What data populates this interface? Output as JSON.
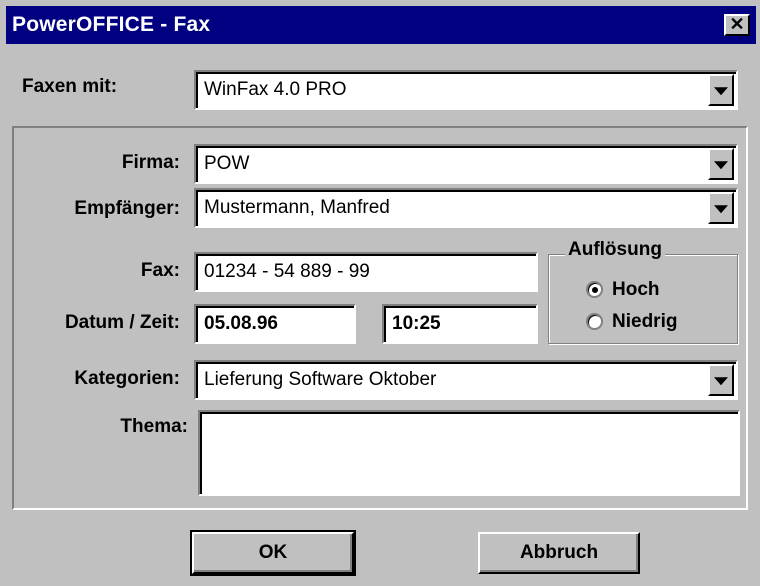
{
  "window": {
    "title": "PowerOFFICE - Fax",
    "close_label": "✕"
  },
  "colors": {
    "titlebar": "#000080",
    "face": "#c0c0c0"
  },
  "fax_with": {
    "label": "Faxen mit:",
    "value": "WinFax 4.0 PRO"
  },
  "firma": {
    "label": "Firma:",
    "value": "POW"
  },
  "empfaenger": {
    "label": "Empfänger:",
    "value": "Mustermann, Manfred"
  },
  "fax": {
    "label": "Fax:",
    "value": "01234 - 54 889 - 99"
  },
  "datetime": {
    "label": "Datum / Zeit:",
    "date": "05.08.96",
    "time": "10:25"
  },
  "resolution": {
    "title": "Auflösung",
    "options": [
      {
        "label": "Hoch",
        "selected": true
      },
      {
        "label": "Niedrig",
        "selected": false
      }
    ]
  },
  "kategorien": {
    "label": "Kategorien:",
    "value": "Lieferung Software Oktober"
  },
  "thema": {
    "label": "Thema:",
    "value": ""
  },
  "buttons": {
    "ok": "OK",
    "cancel": "Abbruch"
  }
}
